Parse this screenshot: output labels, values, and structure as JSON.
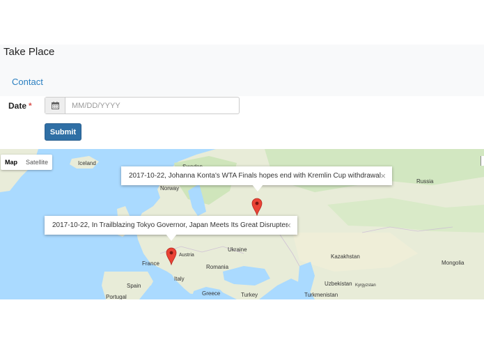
{
  "brand": "Take Place",
  "nav": {
    "contact": "Contact"
  },
  "form": {
    "date_label": "Date",
    "required_mark": "*",
    "date_placeholder": "MM/DD/YYYY",
    "submit_label": "Submit",
    "calendar_icon": "calendar-icon"
  },
  "map": {
    "type_buttons": {
      "map": "Map",
      "satellite": "Satellite"
    },
    "places": {
      "iceland": "Iceland",
      "sweden": "Sweden",
      "norway": "Norway",
      "russia": "Russia",
      "ireland": "Ireland",
      "france": "France",
      "austria": "Austria",
      "ukraine": "Ukraine",
      "romania": "Romania",
      "kazakhstan": "Kazakhstan",
      "mongolia": "Mongolia",
      "spain": "Spain",
      "italy": "Italy",
      "greece": "Greece",
      "turkey": "Turkey",
      "uzbekistan": "Uzbekistan",
      "kyrgyzstan": "Kyrgyzstan",
      "turkmenistan": "Turkmenistan",
      "portugal": "Portugal"
    },
    "infowindows": [
      {
        "text": "2017-10-22, Johanna Konta's WTA Finals hopes end with Kremlin Cup withdrawal",
        "close": "×"
      },
      {
        "text": "2017-10-22, In Trailblazing Tokyo Governor, Japan Meets Its Great Disrupter",
        "close": "×"
      }
    ],
    "colors": {
      "water": "#aadaff",
      "land": "#e8ecd8",
      "forest": "#c8e2b4",
      "marker": "#ea4335"
    }
  }
}
